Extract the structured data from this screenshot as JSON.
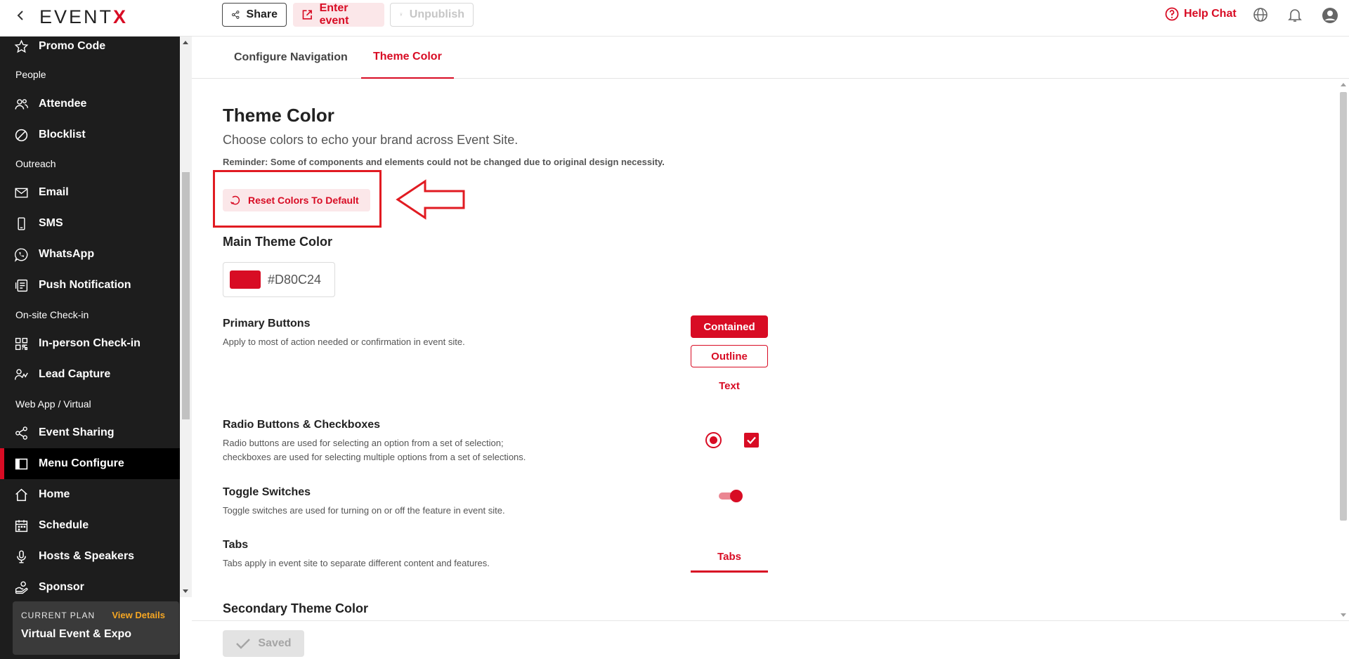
{
  "topbar": {
    "logo_main": "EVENT",
    "logo_accent": "X",
    "share_label": "Share",
    "enter_event_label": "Enter event",
    "unpublish_label": "Unpublish",
    "help_chat_label": "Help Chat"
  },
  "sidebar": {
    "items": [
      {
        "label": "Promo Code",
        "icon": "star-icon"
      },
      {
        "label": "Attendee",
        "icon": "people-icon"
      },
      {
        "label": "Blocklist",
        "icon": "block-icon"
      },
      {
        "label": "Email",
        "icon": "mail-icon"
      },
      {
        "label": "SMS",
        "icon": "phone-icon"
      },
      {
        "label": "WhatsApp",
        "icon": "whatsapp-icon"
      },
      {
        "label": "Push Notification",
        "icon": "notification-icon"
      },
      {
        "label": "In-person Check-in",
        "icon": "qr-icon"
      },
      {
        "label": "Lead Capture",
        "icon": "lead-icon"
      },
      {
        "label": "Event Sharing",
        "icon": "share-icon"
      },
      {
        "label": "Menu Configure",
        "icon": "menu-icon"
      },
      {
        "label": "Home",
        "icon": "home-icon"
      },
      {
        "label": "Schedule",
        "icon": "calendar-icon"
      },
      {
        "label": "Hosts & Speakers",
        "icon": "mic-icon"
      },
      {
        "label": "Sponsor",
        "icon": "sponsor-icon"
      }
    ],
    "sections": [
      "People",
      "Outreach",
      "On-site Check-in",
      "Web App / Virtual"
    ],
    "plan": {
      "label": "CURRENT PLAN",
      "link": "View Details",
      "name": "Virtual Event & Expo"
    }
  },
  "tabs": [
    "Configure Navigation",
    "Theme Color"
  ],
  "theme": {
    "title": "Theme Color",
    "subtitle": "Choose colors to echo your brand across Event Site.",
    "reminder": "Reminder: Some of components and elements could not be changed due to original design necessity.",
    "reset_label": "Reset Colors To Default",
    "main_heading": "Main Theme Color",
    "main_color": "#D80C24",
    "primary_buttons": {
      "title": "Primary Buttons",
      "desc": "Apply to most of action needed or confirmation in event site.",
      "contained": "Contained",
      "outline": "Outline",
      "text": "Text"
    },
    "radio_checkboxes": {
      "title": "Radio Buttons & Checkboxes",
      "desc1": "Radio buttons are used for selecting an option from a set of selection;",
      "desc2": "checkboxes are used for selecting multiple options from a set of selections."
    },
    "toggle": {
      "title": "Toggle Switches",
      "desc": "Toggle switches are used for turning on or off the feature in event site."
    },
    "tabs_row": {
      "title": "Tabs",
      "desc": "Tabs apply in event site to separate different content and features.",
      "demo": "Tabs"
    },
    "secondary_heading": "Secondary Theme Color"
  },
  "footer": {
    "saved_label": "Saved"
  },
  "colors": {
    "brand": "#d80c24",
    "sidebar_bg": "#1d1d1d",
    "plan_link": "#f5a623"
  }
}
